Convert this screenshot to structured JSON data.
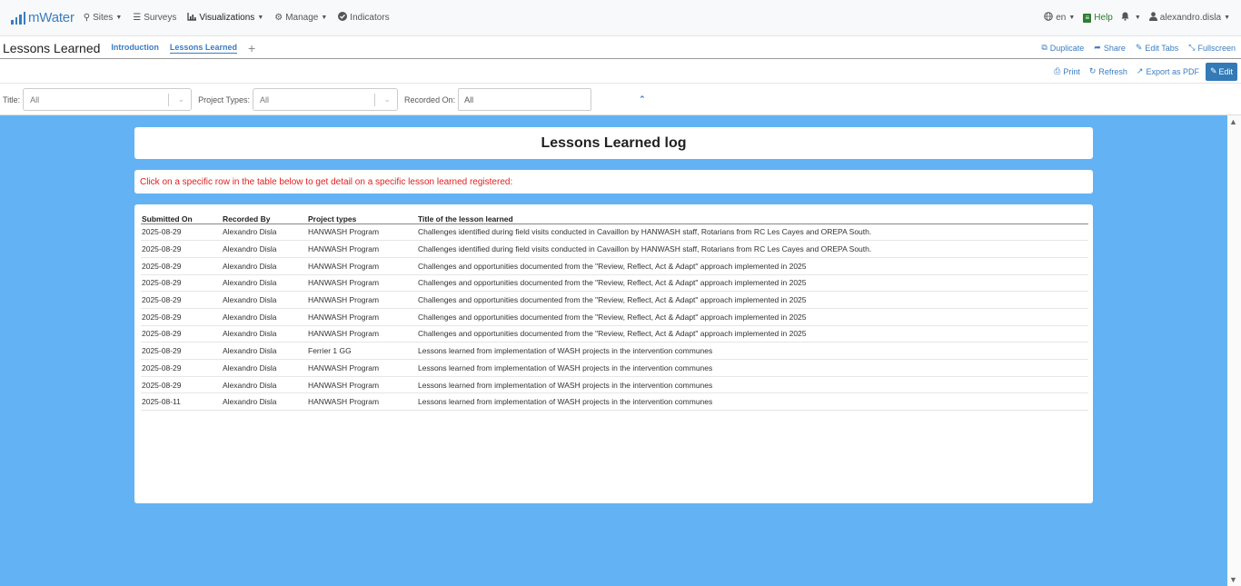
{
  "nav": {
    "logo": "mWater",
    "items": [
      {
        "label": "Sites",
        "icon": "map-marker-icon",
        "caret": true
      },
      {
        "label": "Surveys",
        "icon": "list-icon",
        "caret": false
      },
      {
        "label": "Visualizations",
        "icon": "bar-chart-icon",
        "caret": true
      },
      {
        "label": "Manage",
        "icon": "gear-icon",
        "caret": true
      },
      {
        "label": "Indicators",
        "icon": "check-circle-icon",
        "caret": false
      }
    ],
    "language": "en",
    "help": "Help",
    "user": "alexandro.disla"
  },
  "dashboard": {
    "title": "Lessons Learned",
    "tabs": [
      {
        "label": "Introduction",
        "active": false
      },
      {
        "label": "Lessons Learned",
        "active": true
      }
    ],
    "add_tab": "+",
    "actions": {
      "duplicate": "Duplicate",
      "share": "Share",
      "edit_tabs": "Edit Tabs",
      "fullscreen": "Fullscreen"
    }
  },
  "toolbar": {
    "print": "Print",
    "refresh": "Refresh",
    "export_pdf": "Export as PDF",
    "edit": "Edit"
  },
  "filters": {
    "title_label": "Title:",
    "title_value": "All",
    "project_types_label": "Project Types:",
    "project_types_value": "All",
    "recorded_on_label": "Recorded On:",
    "recorded_on_value": "All"
  },
  "widgets": {
    "title": "Lessons Learned log",
    "instruction": "Click on a specific row in the table below to get detail on a specific lesson learned registered:",
    "table": {
      "columns": [
        "Submitted On",
        "Recorded By",
        "Project types",
        "Title of the lesson learned"
      ],
      "rows": [
        [
          "2025-08-29",
          "Alexandro Disla",
          "HANWASH Program",
          "Challenges identified during field visits conducted in Cavaillon by HANWASH staff, Rotarians from RC Les Cayes and OREPA South."
        ],
        [
          "2025-08-29",
          "Alexandro Disla",
          "HANWASH Program",
          "Challenges identified during field visits conducted in Cavaillon by HANWASH staff, Rotarians from RC Les Cayes and OREPA South."
        ],
        [
          "2025-08-29",
          "Alexandro Disla",
          "HANWASH Program",
          "Challenges and opportunities documented from the \"Review, Reflect, Act & Adapt\" approach implemented in 2025"
        ],
        [
          "2025-08-29",
          "Alexandro Disla",
          "HANWASH Program",
          "Challenges and opportunities documented from the \"Review, Reflect, Act & Adapt\" approach implemented in 2025"
        ],
        [
          "2025-08-29",
          "Alexandro Disla",
          "HANWASH Program",
          "Challenges and opportunities documented from the \"Review, Reflect, Act & Adapt\" approach implemented in 2025"
        ],
        [
          "2025-08-29",
          "Alexandro Disla",
          "HANWASH Program",
          "Challenges and opportunities documented from the \"Review, Reflect, Act & Adapt\" approach implemented in 2025"
        ],
        [
          "2025-08-29",
          "Alexandro Disla",
          "HANWASH Program",
          "Challenges and opportunities documented from the \"Review, Reflect, Act & Adapt\" approach implemented in 2025"
        ],
        [
          "2025-08-29",
          "Alexandro Disla",
          "Ferrier 1 GG",
          "Lessons learned from implementation of WASH projects in the intervention communes"
        ],
        [
          "2025-08-29",
          "Alexandro Disla",
          "HANWASH Program",
          "Lessons learned from implementation of WASH projects in the intervention communes"
        ],
        [
          "2025-08-29",
          "Alexandro Disla",
          "HANWASH Program",
          "Lessons learned from implementation of WASH projects in the intervention communes"
        ],
        [
          "2025-08-11",
          "Alexandro Disla",
          "HANWASH Program",
          "Lessons learned from implementation of WASH projects in the intervention communes"
        ]
      ]
    }
  },
  "colors": {
    "brand": "#3a7dc1",
    "dashboard_bg": "#63b3f4",
    "instruction_text": "#e02020",
    "help": "#2f7d32"
  }
}
